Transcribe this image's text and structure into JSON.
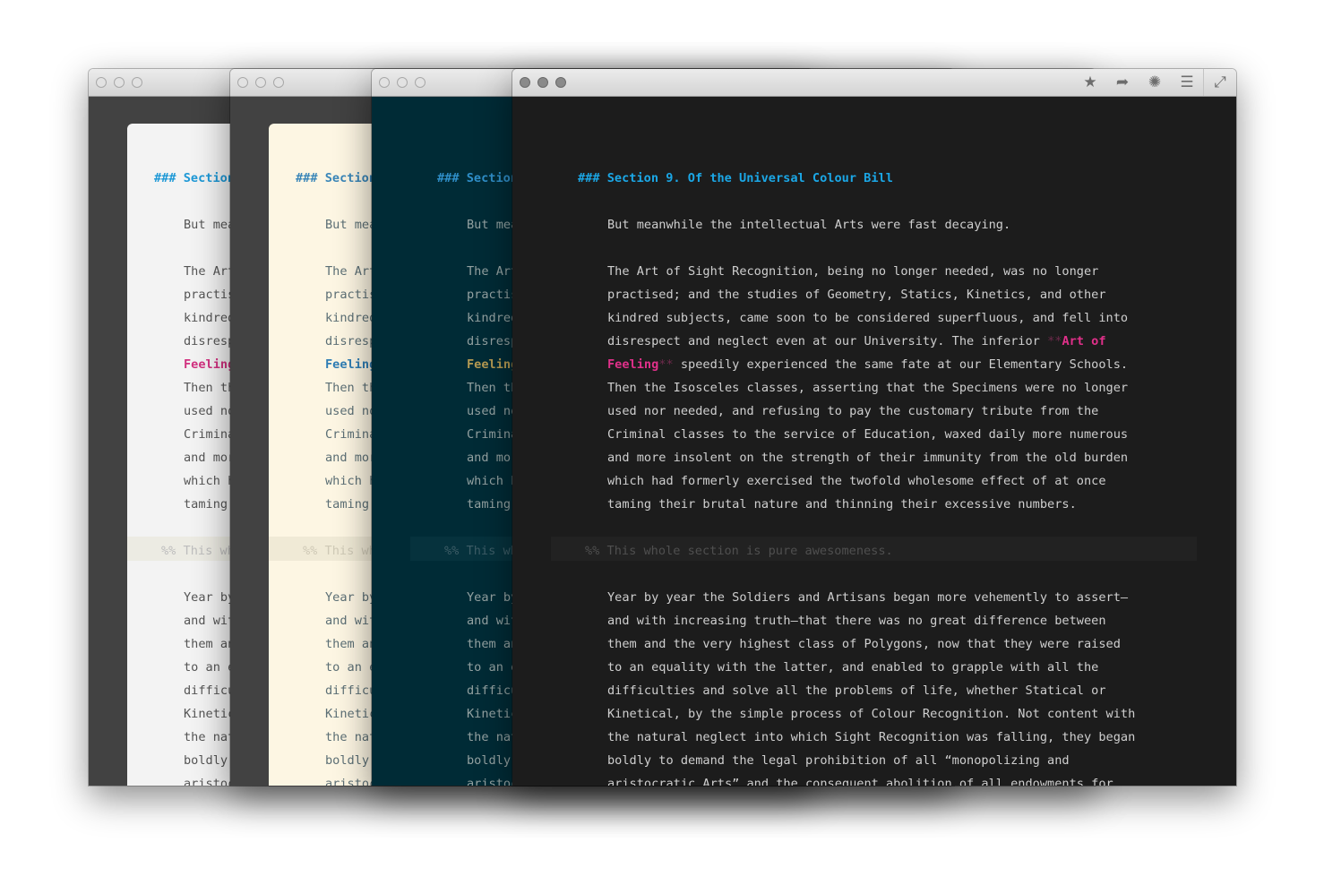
{
  "windows": [
    {
      "name": "light",
      "bg": "#424242",
      "paper": "#f3f3f3",
      "text": "#555555",
      "heading": "#1d98d6",
      "emph": "#d1307f",
      "marker": "#e59bbd",
      "comment": "#bdbdbd",
      "band": "#ecebe3",
      "paper_edge": true
    },
    {
      "name": "solarized-light",
      "bg": "#424242",
      "paper": "#fdf6e3",
      "text": "#5c6f75",
      "heading": "#3a86b8",
      "emph": "#2f7db4",
      "marker": "#9cc3dd",
      "comment": "#cfc9b6",
      "band": "#f0ead6",
      "paper_edge": true
    },
    {
      "name": "solarized-dark",
      "bg": "#002b36",
      "paper": "#002b36",
      "text": "#93a1a1",
      "heading": "#2f8fc9",
      "emph": "#b59a52",
      "marker": "#6d6140",
      "comment": "#3d5c66",
      "band": "#06323d",
      "paper_edge": false
    },
    {
      "name": "dark",
      "bg": "#1c1c1c",
      "paper": "#1c1c1c",
      "text": "#cfcfcf",
      "heading": "#1ba7e6",
      "emph": "#e0308a",
      "marker": "#6d2a4b",
      "comment": "#4f4f4f",
      "band": "#222222",
      "paper_edge": false
    }
  ],
  "toolbar": {
    "star": "★",
    "share": "➦",
    "stats": "✺",
    "list": "☰",
    "fullscreen": "⤢"
  },
  "document": {
    "lines": [
      {
        "t": "h",
        "s": [
          [
            "h",
            "### Section 9. Of the Universal Colour Bill"
          ]
        ]
      },
      {
        "t": "b",
        "s": []
      },
      {
        "t": "p",
        "s": [
          [
            "n",
            "But meanwhile the intellectual Arts were fast decaying."
          ]
        ]
      },
      {
        "t": "b",
        "s": []
      },
      {
        "t": "p",
        "s": [
          [
            "n",
            "The Art of Sight Recognition, being no longer needed, was no longer"
          ]
        ]
      },
      {
        "t": "p",
        "s": [
          [
            "n",
            "practised; and the studies of Geometry, Statics, Kinetics, and other"
          ]
        ]
      },
      {
        "t": "p",
        "s": [
          [
            "n",
            "kindred subjects, came soon to be considered superfluous, and fell into"
          ]
        ]
      },
      {
        "t": "p",
        "s": [
          [
            "n",
            "disrespect and neglect even at our University. The inferior "
          ],
          [
            "m",
            "**"
          ],
          [
            "e",
            "Art of"
          ]
        ]
      },
      {
        "t": "p",
        "s": [
          [
            "e",
            "Feeling"
          ],
          [
            "m",
            "**"
          ],
          [
            "n",
            " speedily experienced the same fate at our Elementary Schools."
          ]
        ]
      },
      {
        "t": "p",
        "s": [
          [
            "n",
            "Then the Isosceles classes, asserting that the Specimens were no longer"
          ]
        ]
      },
      {
        "t": "p",
        "s": [
          [
            "n",
            "used nor needed, and refusing to pay the customary tribute from the"
          ]
        ]
      },
      {
        "t": "p",
        "s": [
          [
            "n",
            "Criminal classes to the service of Education, waxed daily more numerous"
          ]
        ]
      },
      {
        "t": "p",
        "s": [
          [
            "n",
            "and more insolent on the strength of their immunity from the old burden"
          ]
        ]
      },
      {
        "t": "p",
        "s": [
          [
            "n",
            "which had formerly exercised the twofold wholesome effect of at once"
          ]
        ]
      },
      {
        "t": "p",
        "s": [
          [
            "n",
            "taming their brutal nature and thinning their excessive numbers."
          ]
        ]
      },
      {
        "t": "b",
        "s": []
      },
      {
        "t": "c",
        "s": [
          [
            "c",
            "%% This whole section is pure awesomeness."
          ]
        ]
      },
      {
        "t": "b",
        "s": []
      },
      {
        "t": "p",
        "s": [
          [
            "n",
            "Year by year the Soldiers and Artisans began more vehemently to assert—"
          ]
        ]
      },
      {
        "t": "p",
        "s": [
          [
            "n",
            "and with increasing truth—that there was no great difference between"
          ]
        ]
      },
      {
        "t": "p",
        "s": [
          [
            "n",
            "them and the very highest class of Polygons, now that they were raised"
          ]
        ]
      },
      {
        "t": "p",
        "s": [
          [
            "n",
            "to an equality with the latter, and enabled to grapple with all the"
          ]
        ]
      },
      {
        "t": "p",
        "s": [
          [
            "n",
            "difficulties and solve all the problems of life, whether Statical or"
          ]
        ]
      },
      {
        "t": "p",
        "s": [
          [
            "n",
            "Kinetical, by the simple process of Colour Recognition. Not content with"
          ]
        ]
      },
      {
        "t": "p",
        "s": [
          [
            "n",
            "the natural neglect into which Sight Recognition was falling, they began"
          ]
        ]
      },
      {
        "t": "p",
        "s": [
          [
            "n",
            "boldly to demand the legal prohibition of all “monopolizing and"
          ]
        ]
      },
      {
        "t": "p",
        "s": [
          [
            "n",
            "aristocratic Arts” and the consequent abolition of all endowments for"
          ]
        ]
      }
    ]
  }
}
